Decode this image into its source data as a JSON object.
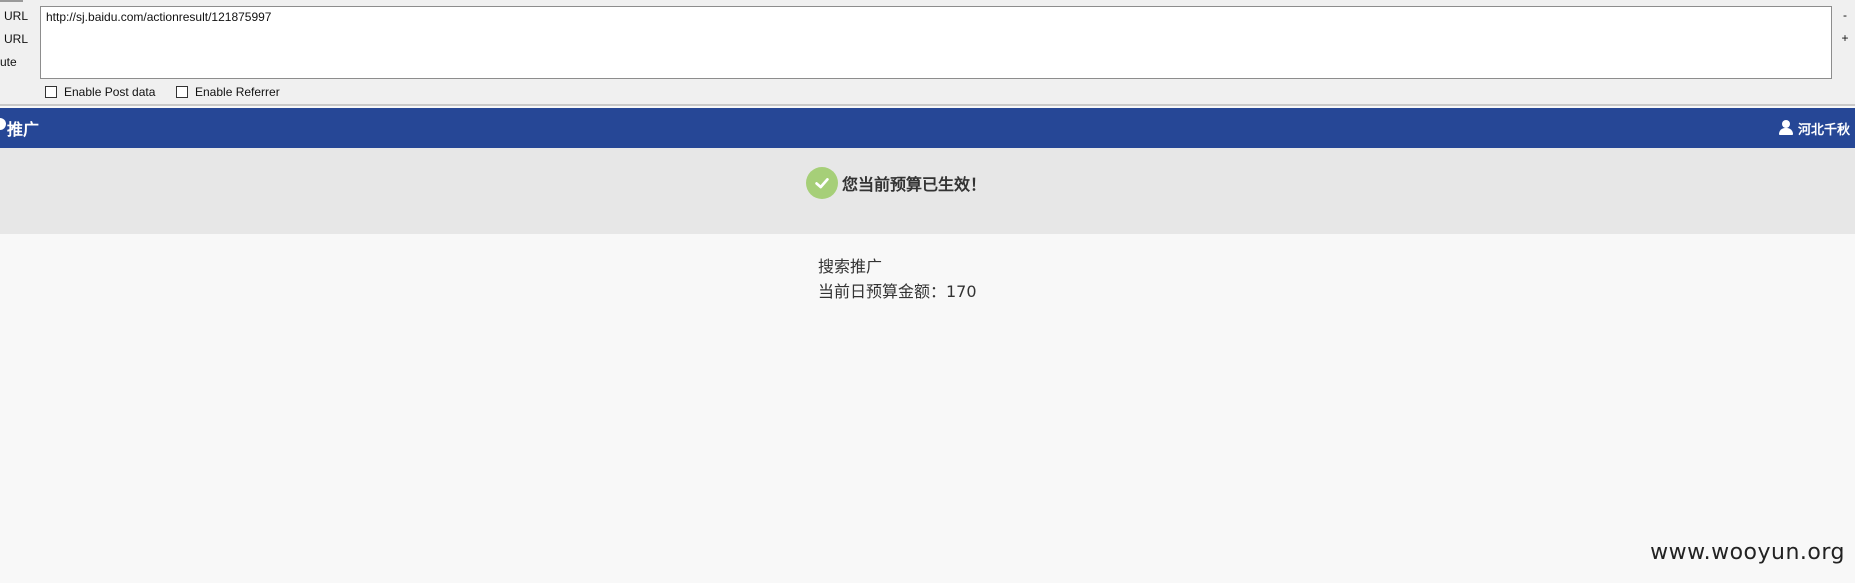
{
  "toolbar": {
    "labels": [
      "URL",
      "URL",
      "ute"
    ],
    "url_value": "http://sj.baidu.com/actionresult/121875997",
    "minus": "-",
    "plus": "+",
    "option_post": "Enable Post data",
    "option_referrer": "Enable Referrer"
  },
  "header": {
    "brand": "推广",
    "user": "河北千秋",
    "bg_color": "#264796"
  },
  "success": {
    "message": "您当前预算已生效！",
    "icon": "check-circle-icon",
    "icon_color": "#a6cf78"
  },
  "content": {
    "product": "搜索推广",
    "budget_line": "当前日预算金额：170"
  },
  "watermark": "www.wooyun.org"
}
